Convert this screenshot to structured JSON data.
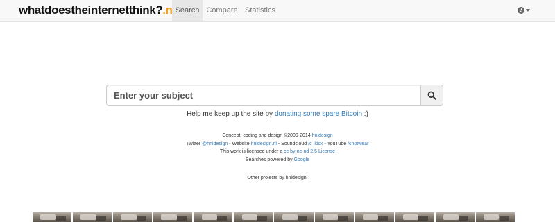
{
  "brand": {
    "main": "whatdoestheinternetthink?",
    "accent": ".net",
    "accent_color": "#f0a020"
  },
  "nav": {
    "tabs": [
      {
        "label": "Search",
        "active": true
      },
      {
        "label": "Compare",
        "active": false
      },
      {
        "label": "Statistics",
        "active": false
      }
    ],
    "help_icon": "question-circle-icon",
    "dropdown_icon": "caret-down-icon"
  },
  "search": {
    "placeholder": "Enter your subject",
    "button_icon": "search-icon"
  },
  "donate": {
    "prefix": "Help me keep up the site by ",
    "link_text": "donating some spare Bitcoin",
    "suffix": " :)"
  },
  "credits": {
    "line1_text": "Concept, coding and design ©2009-2014 ",
    "line1_link": "hnldesign",
    "line2_twitter_label": "Twitter ",
    "line2_twitter_link": "@hnldesign",
    "line2_website_label": " - Website ",
    "line2_website_link": "hnldesign.nl",
    "line2_soundcloud_label": " - Soundcloud ",
    "line2_soundcloud_link": "/c_kick",
    "line2_youtube_label": " - YouTube ",
    "line2_youtube_link": "/cnotwear",
    "line3_text": "This work is licensed under a ",
    "line3_link": "cc by-nc-nd 2.5 License",
    "line4_text": "Searches powered by ",
    "line4_link": "Google"
  },
  "other_projects": {
    "label": "Other projects by hnldesign:",
    "thumbnail_count": 12
  },
  "colors": {
    "link": "#337ab7",
    "navbar_bg": "#f8f8f8",
    "active_tab_bg": "#e7e7e7"
  }
}
